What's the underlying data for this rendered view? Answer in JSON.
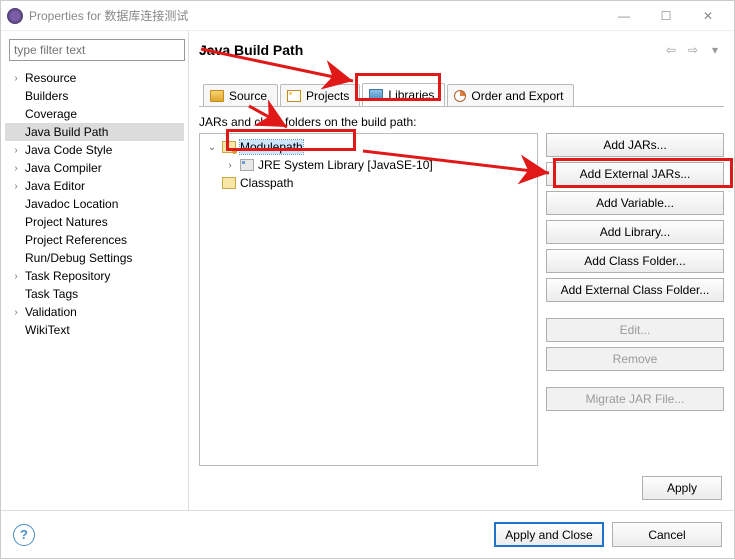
{
  "window": {
    "title": "Properties for 数据库连接测试"
  },
  "filter": {
    "placeholder": "type filter text"
  },
  "sidebar": {
    "items": [
      {
        "label": "Resource",
        "expandable": true
      },
      {
        "label": "Builders",
        "expandable": false
      },
      {
        "label": "Coverage",
        "expandable": false
      },
      {
        "label": "Java Build Path",
        "expandable": false,
        "selected": true
      },
      {
        "label": "Java Code Style",
        "expandable": true
      },
      {
        "label": "Java Compiler",
        "expandable": true
      },
      {
        "label": "Java Editor",
        "expandable": true
      },
      {
        "label": "Javadoc Location",
        "expandable": false
      },
      {
        "label": "Project Natures",
        "expandable": false
      },
      {
        "label": "Project References",
        "expandable": false
      },
      {
        "label": "Run/Debug Settings",
        "expandable": false
      },
      {
        "label": "Task Repository",
        "expandable": true
      },
      {
        "label": "Task Tags",
        "expandable": false
      },
      {
        "label": "Validation",
        "expandable": true
      },
      {
        "label": "WikiText",
        "expandable": false
      }
    ]
  },
  "page": {
    "title": "Java Build Path",
    "tabs": {
      "source": "Source",
      "projects": "Projects",
      "libraries": "Libraries",
      "order": "Order and Export"
    },
    "subtitle": "JARs and class folders on the build path:",
    "tree": {
      "modulepath": "Modulepath",
      "jre": "JRE System Library [JavaSE-10]",
      "classpath": "Classpath"
    },
    "buttons": {
      "add_jars": "Add JARs...",
      "add_ext_jars": "Add External JARs...",
      "add_var": "Add Variable...",
      "add_lib": "Add Library...",
      "add_cf": "Add Class Folder...",
      "add_ecf": "Add External Class Folder...",
      "edit": "Edit...",
      "remove": "Remove",
      "migrate": "Migrate JAR File..."
    },
    "apply": "Apply"
  },
  "footer": {
    "apply_close": "Apply and Close",
    "cancel": "Cancel"
  }
}
